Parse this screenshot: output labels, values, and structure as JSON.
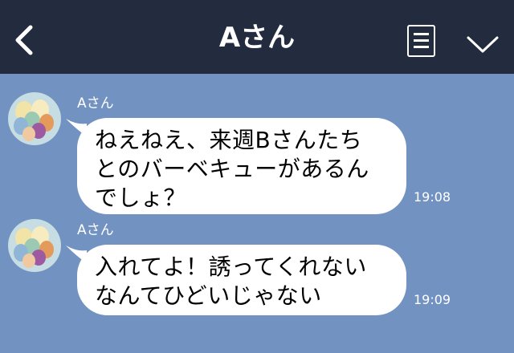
{
  "header": {
    "title": "Aさん",
    "back_icon": "chevron-left-icon",
    "menu_icon": "menu-icon",
    "collapse_icon": "chevron-down-icon"
  },
  "messages": [
    {
      "sender": "Aさん",
      "lines": [
        "ねえねえ、来週Bさんたち",
        "とのバーベキューがあるん",
        "でしょ？"
      ],
      "time": "19:08"
    },
    {
      "sender": "Aさん",
      "lines": [
        "入れてよ！誘ってくれない",
        "なんてひどいじゃない"
      ],
      "time": "19:09"
    }
  ],
  "colors": {
    "header_bg": "#232b3e",
    "chat_bg": "#7293c1",
    "bubble_bg": "#ffffff",
    "header_text": "#ffffff"
  }
}
